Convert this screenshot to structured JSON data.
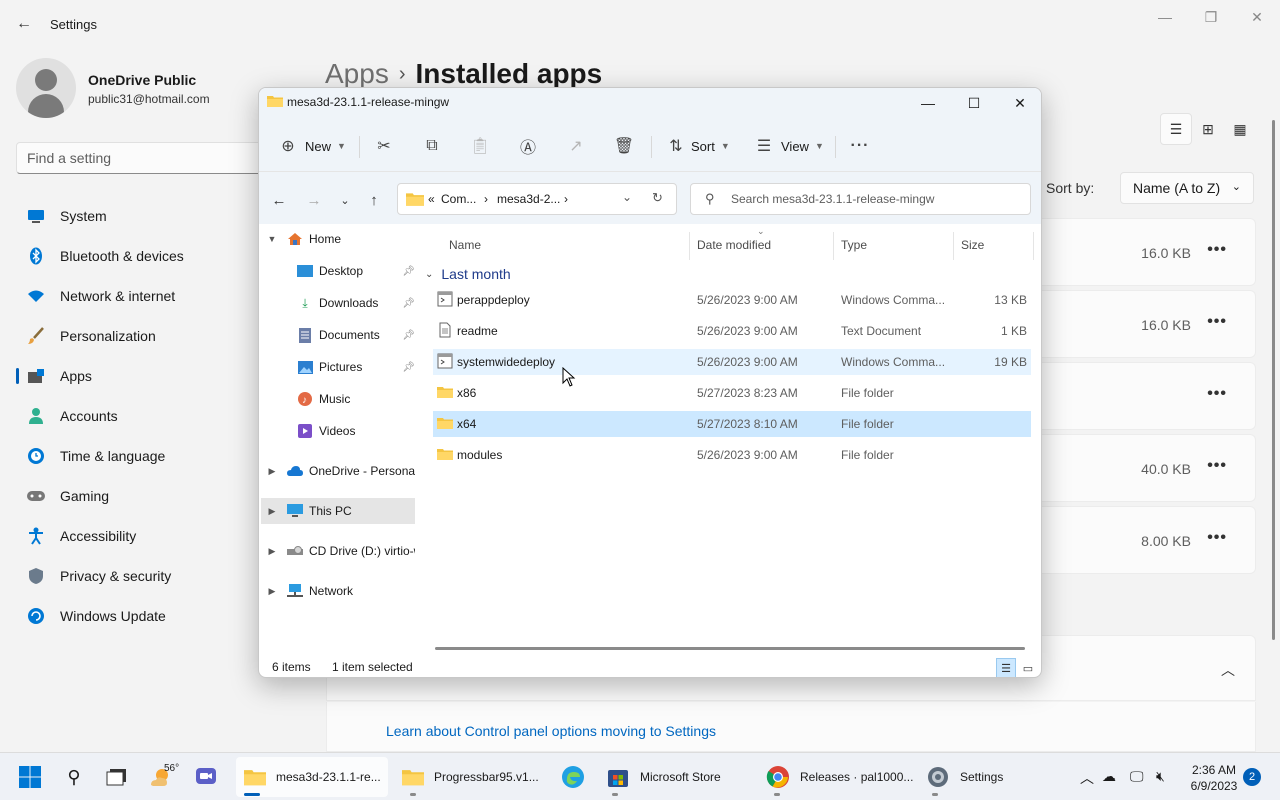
{
  "settings": {
    "title": "Settings",
    "profile": {
      "name": "OneDrive Public",
      "email": "public31@hotmail.com"
    },
    "search_placeholder": "Find a setting",
    "nav": [
      {
        "label": "System",
        "icon": "monitor-icon"
      },
      {
        "label": "Bluetooth & devices",
        "icon": "bluetooth-icon"
      },
      {
        "label": "Network & internet",
        "icon": "wifi-icon"
      },
      {
        "label": "Personalization",
        "icon": "brush-icon"
      },
      {
        "label": "Apps",
        "icon": "apps-icon",
        "active": true
      },
      {
        "label": "Accounts",
        "icon": "person-icon"
      },
      {
        "label": "Time & language",
        "icon": "clock-globe-icon"
      },
      {
        "label": "Gaming",
        "icon": "gamepad-icon"
      },
      {
        "label": "Accessibility",
        "icon": "accessibility-icon"
      },
      {
        "label": "Privacy & security",
        "icon": "shield-icon"
      },
      {
        "label": "Windows Update",
        "icon": "update-icon"
      }
    ],
    "breadcrumb": {
      "parent": "Apps",
      "separator": "›",
      "current": "Installed apps"
    },
    "sort_label": "Sort by:",
    "sort_value": "Name (A to Z)",
    "apps": [
      {
        "size": "16.0 KB"
      },
      {
        "size": "16.0 KB"
      },
      {
        "size": ""
      },
      {
        "size": "40.0 KB"
      },
      {
        "size": "8.00 KB"
      }
    ],
    "more_glyph": "•••",
    "related_link": "Learn about Control panel options moving to Settings"
  },
  "explorer": {
    "title": "mesa3d-23.1.1-release-mingw",
    "toolbar": {
      "new": "New",
      "sort": "Sort",
      "view": "View"
    },
    "address": {
      "prefix": "«",
      "part1": "Com...",
      "sep": "›",
      "part2": "mesa3d-2..."
    },
    "search_placeholder": "Search mesa3d-23.1.1-release-mingw",
    "tree": [
      {
        "label": "Home",
        "icon": "home-icon",
        "level": 0,
        "expanded": true
      },
      {
        "label": "Desktop",
        "icon": "desktop-icon",
        "level": 1,
        "pinned": true
      },
      {
        "label": "Downloads",
        "icon": "download-icon",
        "level": 1,
        "pinned": true
      },
      {
        "label": "Documents",
        "icon": "document-icon",
        "level": 1,
        "pinned": true
      },
      {
        "label": "Pictures",
        "icon": "picture-icon",
        "level": 1,
        "pinned": true
      },
      {
        "label": "Music",
        "icon": "music-icon",
        "level": 1
      },
      {
        "label": "Videos",
        "icon": "video-icon",
        "level": 1
      },
      {
        "label": "OneDrive - Personal",
        "icon": "cloud-icon",
        "level": 0
      },
      {
        "label": "This PC",
        "icon": "pc-icon",
        "level": 0,
        "selected": true
      },
      {
        "label": "CD Drive (D:) virtio-w",
        "icon": "cd-drive-icon",
        "level": 0
      },
      {
        "label": "Network",
        "icon": "network-icon",
        "level": 0
      }
    ],
    "columns": {
      "name": "Name",
      "date": "Date modified",
      "type": "Type",
      "size": "Size"
    },
    "group": "Last month",
    "files": [
      {
        "name": "perappdeploy",
        "date": "5/26/2023 9:00 AM",
        "type": "Windows Comma...",
        "size": "13 KB",
        "icon": "cmd-file-icon"
      },
      {
        "name": "readme",
        "date": "5/26/2023 9:00 AM",
        "type": "Text Document",
        "size": "1 KB",
        "icon": "text-file-icon"
      },
      {
        "name": "systemwidedeploy",
        "date": "5/26/2023 9:00 AM",
        "type": "Windows Comma...",
        "size": "19 KB",
        "icon": "cmd-file-icon",
        "hover": true
      },
      {
        "name": "x86",
        "date": "5/27/2023 8:23 AM",
        "type": "File folder",
        "size": "",
        "icon": "folder-icon"
      },
      {
        "name": "x64",
        "date": "5/27/2023 8:10 AM",
        "type": "File folder",
        "size": "",
        "icon": "folder-icon",
        "selected": true
      },
      {
        "name": "modules",
        "date": "5/26/2023 9:00 AM",
        "type": "File folder",
        "size": "",
        "icon": "folder-icon"
      }
    ],
    "status": {
      "count": "6 items",
      "selection": "1 item selected"
    }
  },
  "taskbar": {
    "weather_temp": "56°",
    "items": [
      {
        "label": "mesa3d-23.1.1-re...",
        "icon": "file-explorer-icon",
        "active": true
      },
      {
        "label": "Progressbar95.v1...",
        "icon": "file-explorer-icon"
      },
      {
        "label": "",
        "icon": "edge-icon"
      },
      {
        "label": "Microsoft Store",
        "icon": "store-icon"
      },
      {
        "label": "Releases · pal1000...",
        "icon": "chrome-icon"
      },
      {
        "label": "Settings",
        "icon": "settings-gear-icon"
      }
    ],
    "time": "2:36 AM",
    "date": "6/9/2023",
    "notifications": "2"
  }
}
